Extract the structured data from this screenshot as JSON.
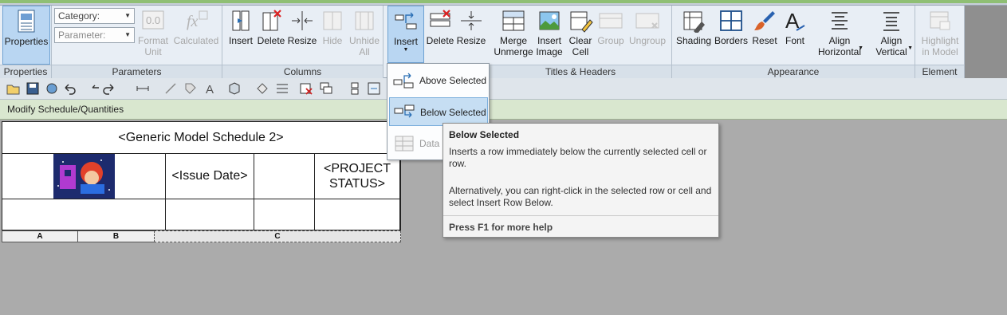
{
  "ribbon": {
    "groups": {
      "properties": "Properties",
      "parameters": "Parameters",
      "columns": "Columns",
      "titles_headers": "Titles & Headers",
      "appearance": "Appearance",
      "element": "Element"
    },
    "properties_btn": "Properties",
    "category_combo": "Category:",
    "parameter_combo": "Parameter:",
    "format_unit": [
      "Format",
      "Unit"
    ],
    "calculated": "Calculated",
    "columns_buttons": {
      "insert": "Insert",
      "delete": "Delete",
      "resize": "Resize",
      "hide": "Hide",
      "unhide": [
        "Unhide",
        "All"
      ]
    },
    "rows_buttons": {
      "insert": "Insert",
      "delete": "Delete",
      "resize": "Resize"
    },
    "titles_buttons": {
      "merge": [
        "Merge",
        "Unmerge"
      ],
      "insert_image": [
        "Insert",
        "Image"
      ],
      "clear_cell": [
        "Clear",
        "Cell"
      ],
      "group": "Group",
      "ungroup": "Ungroup"
    },
    "appearance_buttons": {
      "shading": "Shading",
      "borders": "Borders",
      "reset": "Reset",
      "font": "Font",
      "align_h": [
        "Align",
        "Horizontal"
      ],
      "align_v": [
        "Align",
        "Vertical"
      ]
    },
    "element_buttons": {
      "highlight": [
        "Highlight",
        "in Model"
      ]
    }
  },
  "context_bar": "Modify Schedule/Quantities",
  "schedule": {
    "title": "<Generic Model Schedule 2>",
    "issue_date": "<Issue Date>",
    "project_status": [
      "<PROJECT",
      "STATUS>"
    ],
    "column_headers": [
      "A",
      "B",
      "C"
    ]
  },
  "insert_menu": {
    "items": [
      "Above Selected",
      "Below Selected",
      "Data Row"
    ]
  },
  "tooltip": {
    "title": "Below Selected",
    "body": "Inserts a row immediately below the currently selected cell or row.",
    "body2": "Alternatively, you can right-click in the selected row or cell and select Insert Row Below.",
    "help": "Press F1 for more help"
  },
  "colors": {
    "ribbon_bg": "#e8eef5",
    "context_bar": "#d9e7cf",
    "menu_hover": "#c6def3",
    "canvas": "#ababab"
  }
}
